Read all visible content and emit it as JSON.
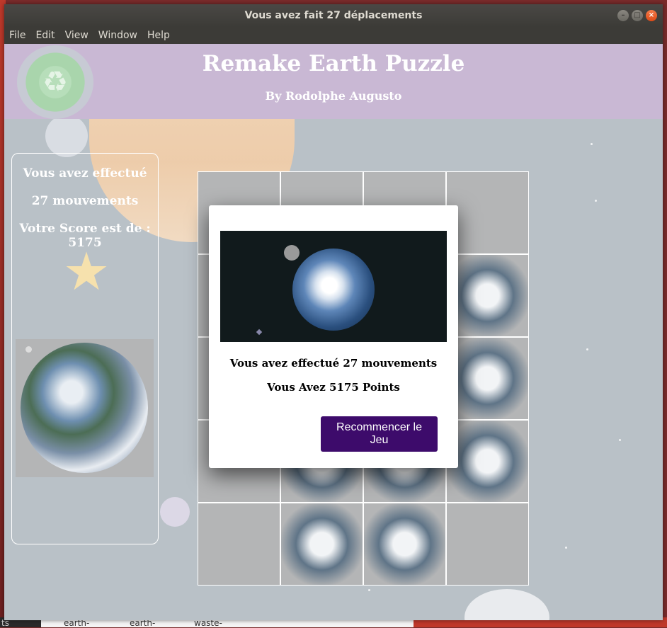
{
  "window": {
    "title": "Vous avez fait 27 déplacements",
    "controls": {
      "minimize": "–",
      "maximize": "□",
      "close": "×"
    }
  },
  "menu": [
    "File",
    "Edit",
    "View",
    "Window",
    "Help"
  ],
  "header": {
    "title": "Remake Earth Puzzle",
    "byline": "By Rodolphe Augusto"
  },
  "score_panel": {
    "line1": "Vous avez effectué",
    "line2": "27 mouvements",
    "line3": "Votre Score est de : 5175",
    "star": "★"
  },
  "modal": {
    "message_moves": "Vous avez effectué 27 mouvements",
    "message_points": "Vous Avez 5175 Points",
    "restart_label": "Recommencer le Jeu"
  },
  "taskbar": {
    "items": [
      "earth-",
      "earth-",
      "waste-"
    ],
    "left_fragment": "ts"
  },
  "colors": {
    "header_bg": "#c9b8d4",
    "button_bg": "#3d0b6b",
    "star": "#f6e1ad"
  }
}
